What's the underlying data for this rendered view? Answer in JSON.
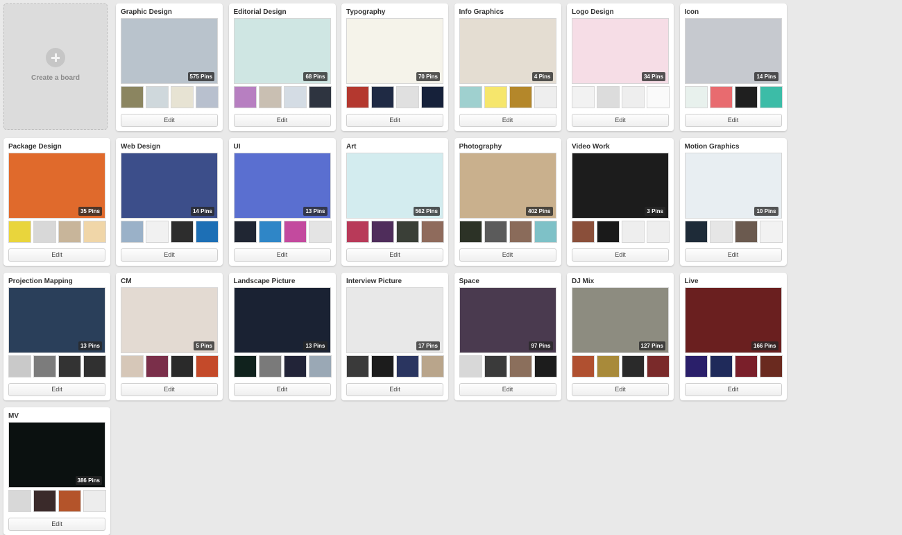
{
  "create_board": {
    "label": "Create a board"
  },
  "edit_label": "Edit",
  "boards": [
    {
      "title": "Graphic Design",
      "count": "575 Pins",
      "cover": "#b9c3cc",
      "thumbs": [
        "#8b8560",
        "#cfd8dc",
        "#e7e3d3",
        "#b8c0ce"
      ]
    },
    {
      "title": "Editorial Design",
      "count": "68 Pins",
      "cover": "#cfe6e3",
      "thumbs": [
        "#b77fc1",
        "#c9bfb2",
        "#d4dce4",
        "#2e3440"
      ]
    },
    {
      "title": "Typography",
      "count": "70 Pins",
      "cover": "#f5f3ea",
      "thumbs": [
        "#b4382f",
        "#1f2a44",
        "#e0e0e0",
        "#16213a"
      ]
    },
    {
      "title": "Info Graphics",
      "count": "4 Pins",
      "cover": "#e4ddd2",
      "thumbs": [
        "#9fd0cf",
        "#f6e66c",
        "#b4872a",
        "#eeeeee"
      ]
    },
    {
      "title": "Logo Design",
      "count": "34 Pins",
      "cover": "#f6dde6",
      "thumbs": [
        "#f2f2f2",
        "#dcdcdc",
        "#eeeeee",
        "#fafafa"
      ]
    },
    {
      "title": "Icon",
      "count": "14 Pins",
      "cover": "#c6c9cf",
      "thumbs": [
        "#e8f1ed",
        "#e86b6f",
        "#1f1f1f",
        "#3cbca7"
      ]
    },
    {
      "title": "Package Design",
      "count": "35 Pins",
      "cover": "#e06a2c",
      "thumbs": [
        "#e9d53c",
        "#d8d8d8",
        "#c8b59a",
        "#f0d6a8"
      ]
    },
    {
      "title": "Web Design",
      "count": "14 Pins",
      "cover": "#3c4e8a",
      "thumbs": [
        "#9ab1c8",
        "#f1f1f1",
        "#2d2d2d",
        "#1d6fb5"
      ]
    },
    {
      "title": "UI",
      "count": "13 Pins",
      "cover": "#5a6fd0",
      "thumbs": [
        "#202633",
        "#2f86c7",
        "#c34a9e",
        "#e4e4e4"
      ]
    },
    {
      "title": "Art",
      "count": "562 Pins",
      "cover": "#d3ecef",
      "thumbs": [
        "#b83a59",
        "#4f2d5b",
        "#3a3f37",
        "#8f6b5c"
      ]
    },
    {
      "title": "Photography",
      "count": "402 Pins",
      "cover": "#c9b08d",
      "thumbs": [
        "#2c3226",
        "#5b5b5b",
        "#8a6b5a",
        "#7ec1c7"
      ]
    },
    {
      "title": "Video Work",
      "count": "3 Pins",
      "cover": "#1c1c1c",
      "thumbs": [
        "#8a4f3a",
        "#1a1a1a",
        "#eeeeee",
        "#eeeeee"
      ]
    },
    {
      "title": "Motion Graphics",
      "count": "10 Pins",
      "cover": "#e8eef2",
      "thumbs": [
        "#1e2b38",
        "#e6e6e6",
        "#6b5a4f",
        "#f2f2f2"
      ]
    },
    {
      "title": "Projection Mapping",
      "count": "13 Pins",
      "cover": "#2a3f5a",
      "thumbs": [
        "#c9c9c9",
        "#7c7c7c",
        "#333333",
        "#303030"
      ]
    },
    {
      "title": "CM",
      "count": "5 Pins",
      "cover": "#e3dad2",
      "thumbs": [
        "#d6c7b8",
        "#7a2f4a",
        "#2a2a2a",
        "#c44a2a"
      ]
    },
    {
      "title": "Landscape Picture",
      "count": "13 Pins",
      "cover": "#1a2233",
      "thumbs": [
        "#10221d",
        "#7a7a7a",
        "#222438",
        "#9aa8b5"
      ]
    },
    {
      "title": "Interview Picture",
      "count": "17 Pins",
      "cover": "#e8e8e8",
      "thumbs": [
        "#3a3a3a",
        "#1c1c1c",
        "#2a3560",
        "#b9a58b"
      ]
    },
    {
      "title": "Space",
      "count": "97 Pins",
      "cover": "#4a3a4f",
      "thumbs": [
        "#d8d8d8",
        "#3a3a3a",
        "#8b6f5c",
        "#1c1c1c"
      ]
    },
    {
      "title": "DJ Mix",
      "count": "127 Pins",
      "cover": "#8d8c80",
      "thumbs": [
        "#b05030",
        "#a88a3a",
        "#2a2a2a",
        "#7a2a2a"
      ]
    },
    {
      "title": "Live",
      "count": "166 Pins",
      "cover": "#6a1f1f",
      "thumbs": [
        "#2a1f6a",
        "#1f2a5a",
        "#7a1f2a",
        "#6a2a1f"
      ]
    },
    {
      "title": "MV",
      "count": "386 Pins",
      "cover": "#0b1110",
      "thumbs": [
        "#d8d8d8",
        "#3a2a2a",
        "#b4542a",
        "#ededed"
      ]
    }
  ]
}
